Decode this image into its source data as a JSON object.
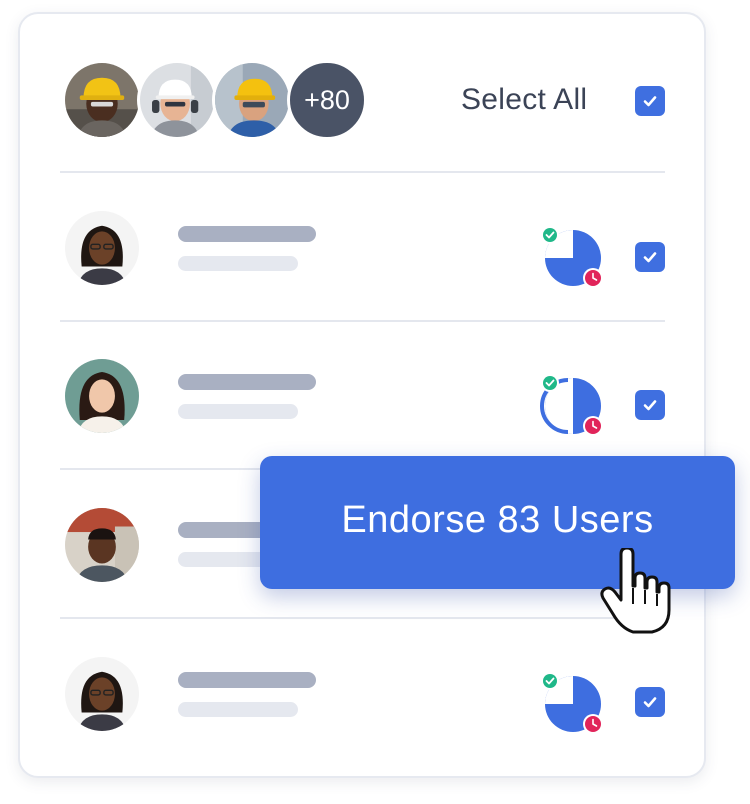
{
  "header": {
    "more_count": "+80",
    "select_all_label": "Select All"
  },
  "users": [
    {
      "status": "partial-3q"
    },
    {
      "status": "partial-half"
    },
    {
      "status": "hidden"
    },
    {
      "status": "partial-3q"
    }
  ],
  "action": {
    "endorse_label": "Endorse 83 Users"
  },
  "colors": {
    "accent": "#3e6ee0",
    "badge": "#4a5366",
    "check_green": "#20b889",
    "clock_pink": "#e1245a"
  }
}
